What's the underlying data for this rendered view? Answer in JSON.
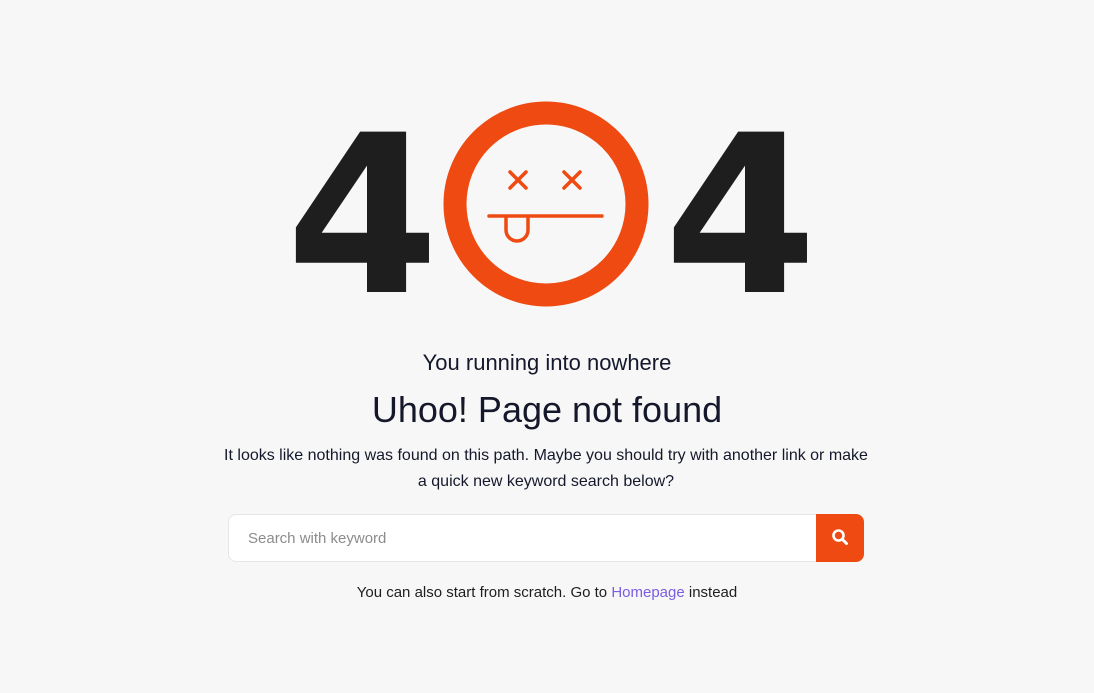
{
  "hero": {
    "digit_left": "4",
    "digit_right": "4",
    "face_icon": "dead-face-icon",
    "accent_color": "#ee4a12"
  },
  "content": {
    "subtitle": "You running into nowhere",
    "title": "Uhoo! Page not found",
    "description": "It looks like nothing was found on this path. Maybe you should try with another link or make a quick new keyword search below?"
  },
  "search": {
    "placeholder": "Search with keyword",
    "value": "",
    "button_icon": "search-icon"
  },
  "footer": {
    "prefix": "You can also start from scratch. Go to",
    "link_label": "Homepage",
    "suffix": "instead",
    "link_color": "#7a5de0"
  }
}
